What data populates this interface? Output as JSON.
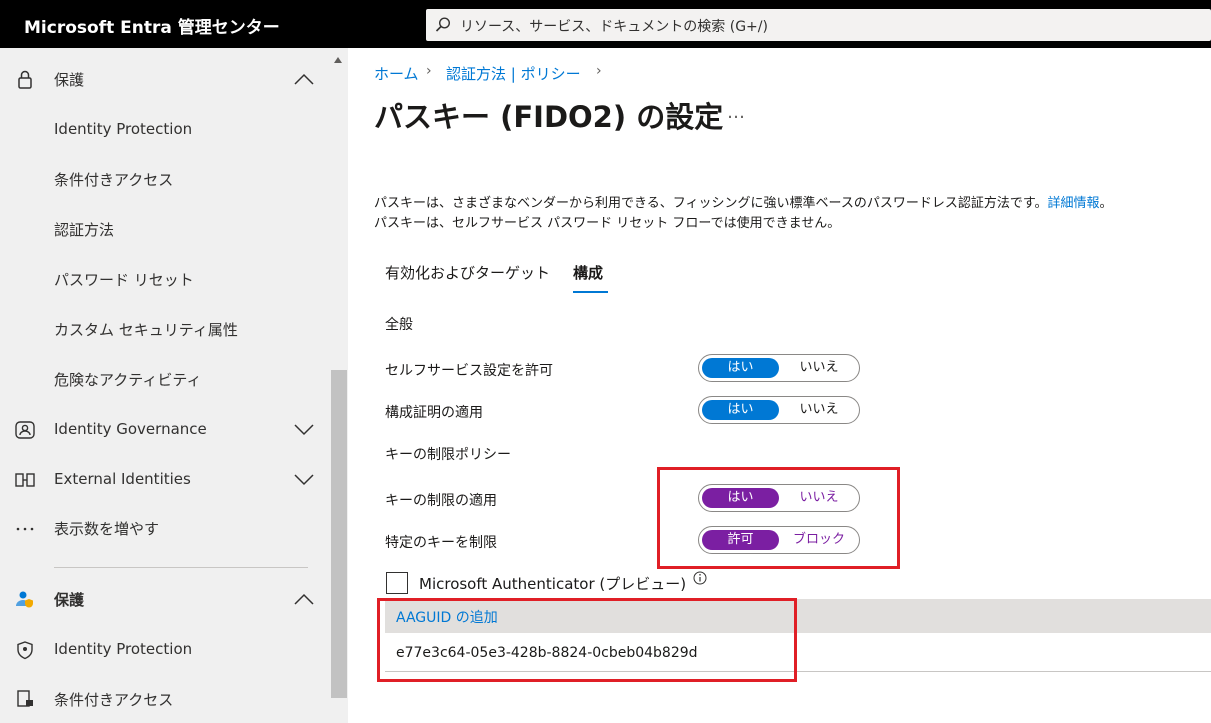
{
  "header": {
    "brand": "Microsoft Entra 管理センター",
    "search_placeholder": "リソース、サービス、ドキュメントの検索 (G+/)"
  },
  "sidebar": {
    "group1": {
      "label": "保護",
      "items": [
        "Identity Protection",
        "条件付きアクセス",
        "認証方法",
        "パスワード リセット",
        "カスタム セキュリティ属性",
        "危険なアクティビティ"
      ]
    },
    "identity_governance": "Identity Governance",
    "external_identities": "External Identities",
    "show_more": "表示数を増やす",
    "group2": {
      "label": "保護",
      "items": [
        "Identity Protection",
        "条件付きアクセス"
      ]
    }
  },
  "breadcrumb": [
    "ホーム",
    "認証方法 | ポリシー"
  ],
  "page": {
    "title": "パスキー (FIDO2) の設定",
    "more": "…",
    "desc_line1": "パスキーは、さまざまなベンダーから利用できる、フィッシングに強い標準ベースのパスワードレス認証方法です。",
    "desc_link": "詳細情報",
    "desc_line1_end": "。",
    "desc_line2": "パスキーは、セルフサービス パスワード リセット フローでは使用できません。"
  },
  "tabs": [
    "有効化およびターゲット",
    "構成"
  ],
  "config": {
    "general_heading": "全般",
    "self_service": {
      "label": "セルフサービス設定を許可",
      "on": "はい",
      "off": "いいえ"
    },
    "attestation": {
      "label": "構成証明の適用",
      "on": "はい",
      "off": "いいえ"
    },
    "key_restriction_heading": "キーの制限ポリシー",
    "enforce_restrictions": {
      "label": "キーの制限の適用",
      "on": "はい",
      "off": "いいえ"
    },
    "restrict_specific": {
      "label": "特定のキーを制限",
      "on": "許可",
      "off": "ブロック"
    },
    "authenticator_checkbox": "Microsoft Authenticator (プレビュー)",
    "add_aaguid": "AAGUID の追加",
    "aaguid_value": "e77e3c64-05e3-428b-8824-0cbeb04b829d"
  },
  "colors": {
    "accent_blue": "#0078d4",
    "purple": "#7b1fa2",
    "highlight_red": "#e01f26"
  }
}
